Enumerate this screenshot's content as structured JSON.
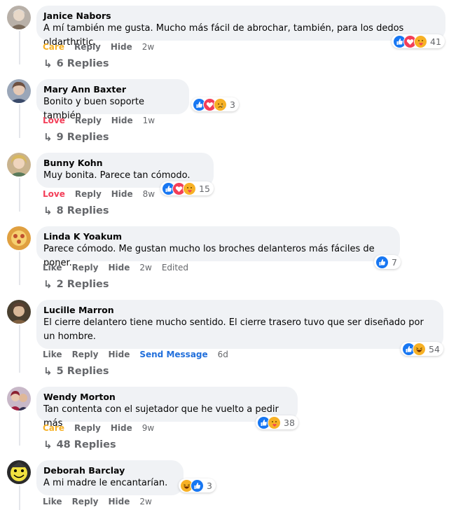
{
  "comments": [
    {
      "author": "Janice Nabors",
      "text": "A mí también me gusta. Mucho más fácil de abrochar, también, para los dedos oldarthritic.",
      "reaction_label": "Care",
      "reaction_color": "#f7b125",
      "reply": "Reply",
      "hide": "Hide",
      "extra": "",
      "time": "2w",
      "edited": "",
      "reaction_icons": [
        "like",
        "love",
        "care"
      ],
      "reaction_count": "41",
      "replies": "6 Replies"
    },
    {
      "author": "Mary Ann Baxter",
      "text": "Bonito y buen soporte también",
      "reaction_label": "Love",
      "reaction_color": "#f33e58",
      "reply": "Reply",
      "hide": "Hide",
      "extra": "",
      "time": "1w",
      "edited": "",
      "reaction_icons": [
        "like",
        "love",
        "sad"
      ],
      "reaction_count": "3",
      "replies": "9 Replies"
    },
    {
      "author": "Bunny Kohn",
      "text": "Muy bonita. Parece tan cómodo.",
      "reaction_label": "Love",
      "reaction_color": "#f33e58",
      "reply": "Reply",
      "hide": "Hide",
      "extra": "",
      "time": "8w",
      "edited": "",
      "reaction_icons": [
        "like",
        "love",
        "care"
      ],
      "reaction_count": "15",
      "replies": "8 Replies"
    },
    {
      "author": "Linda K Yoakum",
      "text": "Parece cómodo. Me gustan mucho los broches delanteros más fáciles de poner.",
      "reaction_label": "Like",
      "reaction_color": "#65676b",
      "reply": "Reply",
      "hide": "Hide",
      "extra": "",
      "time": "2w",
      "edited": "Edited",
      "reaction_icons": [
        "like"
      ],
      "reaction_count": "7",
      "replies": "2 Replies"
    },
    {
      "author": "Lucille Marron",
      "text": "El cierre delantero tiene mucho sentido. El cierre trasero tuvo que ser diseñado por un hombre.",
      "reaction_label": "Like",
      "reaction_color": "#65676b",
      "reply": "Reply",
      "hide": "Hide",
      "extra": "Send Message",
      "time": "6d",
      "edited": "",
      "reaction_icons": [
        "like",
        "haha"
      ],
      "reaction_count": "54",
      "replies": "5 Replies"
    },
    {
      "author": "Wendy Morton",
      "text": "Tan contenta con el sujetador que he vuelto a pedir más",
      "reaction_label": "Care",
      "reaction_color": "#f7b125",
      "reply": "Reply",
      "hide": "Hide",
      "extra": "",
      "time": "9w",
      "edited": "",
      "reaction_icons": [
        "like",
        "care"
      ],
      "reaction_count": "38",
      "replies": "48 Replies"
    },
    {
      "author": "Deborah Barclay",
      "text": "A mi madre le encantarían.",
      "reaction_label": "Like",
      "reaction_color": "#65676b",
      "reply": "Reply",
      "hide": "Hide",
      "extra": "",
      "time": "2w",
      "edited": "",
      "reaction_icons": [
        "haha",
        "like"
      ],
      "reaction_count": "3",
      "replies": ""
    }
  ],
  "colors": {
    "like": "#1877f2",
    "love": "#f33e58",
    "care": "#f7b125",
    "link": "#216fdb"
  }
}
